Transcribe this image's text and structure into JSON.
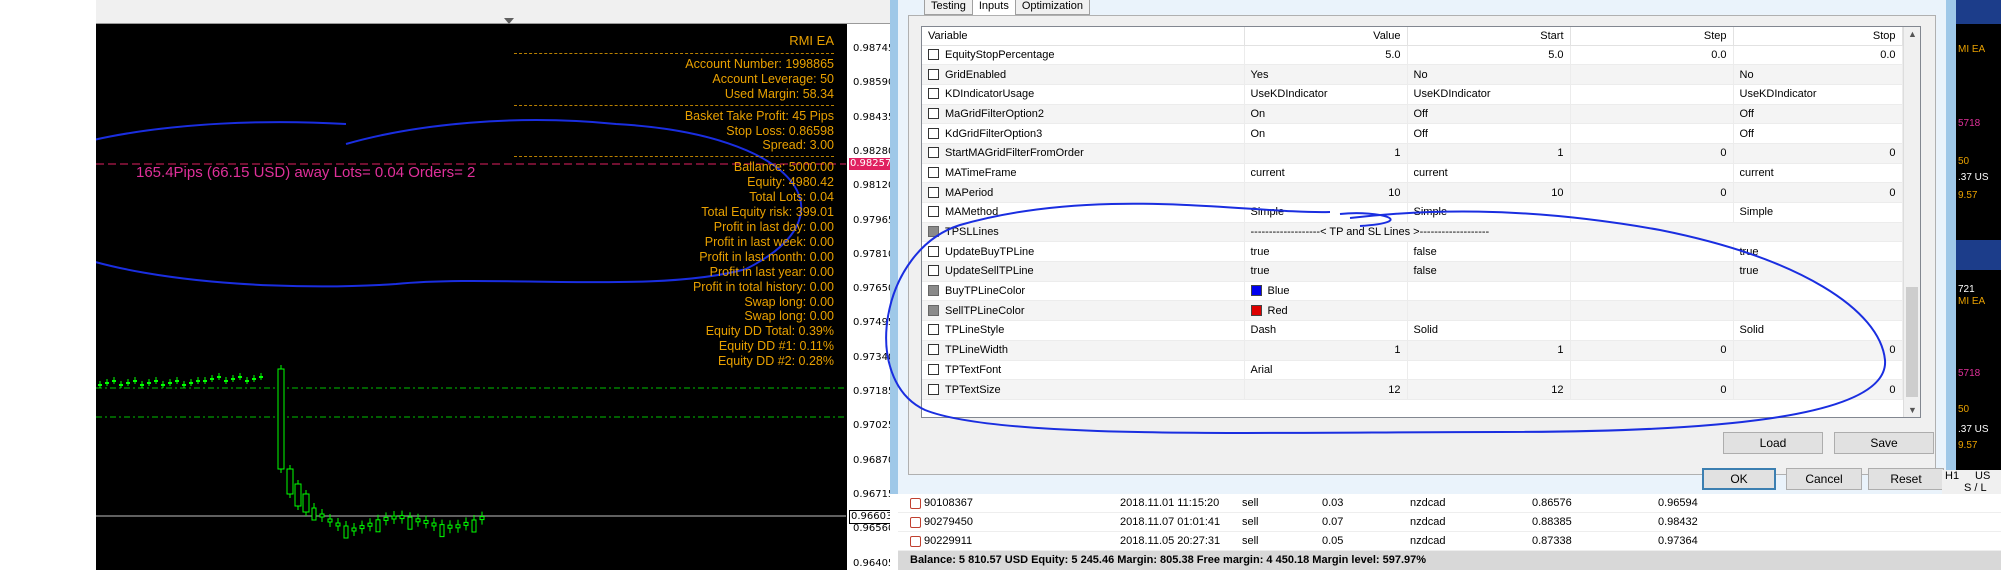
{
  "chart": {
    "ea_title": "RMI EA",
    "account_number": "Account Number: 1998865",
    "account_leverage": "Account Leverage: 50",
    "used_margin": "Used Margin: 58.34",
    "basket_tp": "Basket Take Profit: 45 Pips",
    "stop_loss": "Stop Loss: 0.86598",
    "spread": "Spread: 3.00",
    "ballance": "Ballance: 5000.00",
    "equity": "Equity: 4980.42",
    "total_lots": "Total Lots: 0.04",
    "total_equity_risk": "Total Equity risk: 399.01",
    "profit_day": "Profit in last day: 0.00",
    "profit_week": "Profit in last week: 0.00",
    "profit_month": "Profit in last month: 0.00",
    "profit_year": "Profit in last year: 0.00",
    "profit_total": "Profit in total history: 0.00",
    "swap_long_1": "Swap long: 0.00",
    "swap_long_2": "Swap long: 0.00",
    "equity_dd_total": "Equity DD Total: 0.39%",
    "equity_dd_1": "Equity DD #1: 0.11%",
    "equity_dd_2": "Equity DD #2: 0.28%",
    "pips_line": "165.4Pips (66.15 USD) away Lots= 0.04 Orders= 2",
    "price_labels": [
      "0.98745",
      "0.98590",
      "0.98435",
      "0.98280",
      "0.98120",
      "0.97965",
      "0.97810",
      "0.97650",
      "0.97495",
      "0.97340",
      "0.97185",
      "0.97025",
      "0.96870",
      "0.96715",
      "0.96560",
      "0.96405"
    ],
    "price_current": "0.96603",
    "price_marked": "0.98257",
    "colors": {
      "text": "#e8a000",
      "pips": "#e0309a",
      "candle": "#00ff00",
      "line": "#e02060"
    }
  },
  "dialog": {
    "tabs": [
      "Testing",
      "Inputs",
      "Optimization"
    ],
    "active_tab": "Inputs",
    "columns": {
      "variable": "Variable",
      "value": "Value",
      "start": "Start",
      "step": "Step",
      "stop": "Stop"
    },
    "rows": [
      {
        "name": "EquityStopPercentage",
        "value": "5.0",
        "start": "5.0",
        "step": "0.0",
        "stop": "0.0",
        "num": true
      },
      {
        "name": "GridEnabled",
        "value": "Yes",
        "start": "No",
        "step": "",
        "stop": "No"
      },
      {
        "name": "KDIndicatorUsage",
        "value": "UseKDIndicator",
        "start": "UseKDIndicator",
        "step": "",
        "stop": "UseKDIndicator"
      },
      {
        "name": "MaGridFilterOption2",
        "value": "On",
        "start": "Off",
        "step": "",
        "stop": "Off"
      },
      {
        "name": "KdGridFilterOption3",
        "value": "On",
        "start": "Off",
        "step": "",
        "stop": "Off"
      },
      {
        "name": "StartMAGridFilterFromOrder",
        "value": "1",
        "start": "1",
        "step": "0",
        "stop": "0",
        "num": true
      },
      {
        "name": "MATimeFrame",
        "value": "current",
        "start": "current",
        "step": "",
        "stop": "current"
      },
      {
        "name": "MAPeriod",
        "value": "10",
        "start": "10",
        "step": "0",
        "stop": "0",
        "num": true
      },
      {
        "name": "MAMethod",
        "value": "Simple",
        "start": "Simple",
        "step": "",
        "stop": "Simple"
      },
      {
        "name": "TPSLLines",
        "value": "-------------------< TP and SL Lines >-------------------",
        "start": "",
        "step": "",
        "stop": "",
        "separator": true
      },
      {
        "name": "UpdateBuyTPLine",
        "value": "true",
        "start": "false",
        "step": "",
        "stop": "true"
      },
      {
        "name": "UpdateSellTPLine",
        "value": "true",
        "start": "false",
        "step": "",
        "stop": "true"
      },
      {
        "name": "BuyTPLineColor",
        "value": "Blue",
        "start": "",
        "step": "",
        "stop": "",
        "swatch": "#0000ee",
        "gray": true
      },
      {
        "name": "SellTPLineColor",
        "value": "Red",
        "start": "",
        "step": "",
        "stop": "",
        "swatch": "#dd0000",
        "gray": true
      },
      {
        "name": "TPLineStyle",
        "value": "Dash",
        "start": "Solid",
        "step": "",
        "stop": "Solid"
      },
      {
        "name": "TPLineWidth",
        "value": "1",
        "start": "1",
        "step": "0",
        "stop": "0",
        "num": true
      },
      {
        "name": "TPTextFont",
        "value": "Arial",
        "start": "",
        "step": "",
        "stop": ""
      },
      {
        "name": "TPTextSize",
        "value": "12",
        "start": "12",
        "step": "0",
        "stop": "0",
        "num": true
      }
    ],
    "buttons": {
      "load": "Load",
      "save": "Save",
      "ok": "OK",
      "cancel": "Cancel",
      "reset": "Reset"
    }
  },
  "orders": {
    "rows": [
      {
        "ticket": "90108367",
        "time": "2018.11.01 11:15:20",
        "type": "sell",
        "size": "0.03",
        "symbol": "nzdcad",
        "price": "0.86576",
        "sl": "0.96594"
      },
      {
        "ticket": "90279450",
        "time": "2018.11.07 01:01:41",
        "type": "sell",
        "size": "0.07",
        "symbol": "nzdcad",
        "price": "0.88385",
        "sl": "0.98432"
      },
      {
        "ticket": "90229911",
        "time": "2018.11.05 20:27:31",
        "type": "sell",
        "size": "0.05",
        "symbol": "nzdcad",
        "price": "0.87338",
        "sl": "0.97364"
      }
    ],
    "balance_line": "Balance: 5 810.57 USD  Equity: 5 245.46  Margin: 805.38  Free margin: 4 450.18  Margin level: 597.97%",
    "header_h1": "H1",
    "header_us": "US",
    "header_sl": "S / L"
  },
  "right_strip": {
    "labels": [
      "MI EA",
      "5718",
      "50",
      ".37 US",
      "9.57",
      "721",
      "MI EA",
      "5718",
      "50",
      ".37 US",
      "9.57"
    ]
  }
}
